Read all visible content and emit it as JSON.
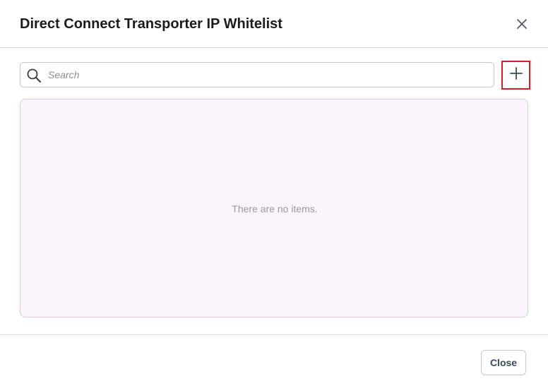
{
  "dialog": {
    "title": "Direct Connect Transporter IP Whitelist",
    "close_icon": "close-x-icon"
  },
  "search": {
    "placeholder": "Search",
    "value": "",
    "icon": "search-icon"
  },
  "toolbar": {
    "add_icon": "plus-icon"
  },
  "list": {
    "empty_message": "There are no items."
  },
  "footer": {
    "close_label": "Close"
  },
  "colors": {
    "add_button_border": "#d61f26",
    "list_background": "#fbf4fc",
    "icon_color": "#3c4a5c"
  }
}
